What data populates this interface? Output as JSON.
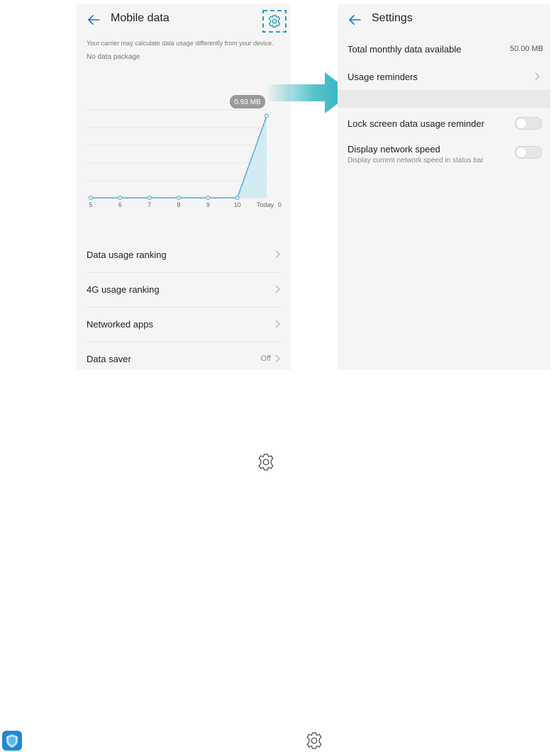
{
  "left_screen": {
    "title": "Mobile data",
    "carrier_note": "Your carrier may calculate data usage differently from your device.",
    "package_status": "No data package",
    "items": [
      {
        "label": "Data usage ranking",
        "value": ""
      },
      {
        "label": "4G usage ranking",
        "value": ""
      },
      {
        "label": "Networked apps",
        "value": ""
      },
      {
        "label": "Data saver",
        "value": "Off"
      }
    ],
    "icons": {
      "back": "back-arrow-icon",
      "settings": "gear-icon"
    }
  },
  "chart_data": {
    "type": "line",
    "categories": [
      "5",
      "6",
      "7",
      "8",
      "9",
      "10",
      "Today"
    ],
    "values": [
      0,
      0,
      0,
      0,
      0,
      0,
      0.93
    ],
    "tooltip": "0.93 MB",
    "y_zero_label": "0",
    "ylim": [
      0,
      1
    ],
    "grid": true,
    "colors": {
      "line": "#4fb3cc",
      "fill": "#c9e9f2",
      "tooltip_bg": "#9a9a9a"
    }
  },
  "right_screen": {
    "title": "Settings",
    "rows": [
      {
        "label": "Total monthly data available",
        "value": "50.00 MB"
      },
      {
        "label": "Usage reminders"
      }
    ],
    "toggles": [
      {
        "label": "Lock screen data usage reminder",
        "subtitle": "",
        "state": "off"
      },
      {
        "label": "Display network speed",
        "subtitle": "Display current network speed in status bar",
        "state": "off"
      }
    ]
  },
  "arrow_color": "#2bb3c0",
  "highlight_color": "#2a9fb0",
  "bottom_icons": {
    "manager_app": "shield-app-icon",
    "gear_mid": "gear-icon",
    "gear_bottom": "gear-icon"
  }
}
